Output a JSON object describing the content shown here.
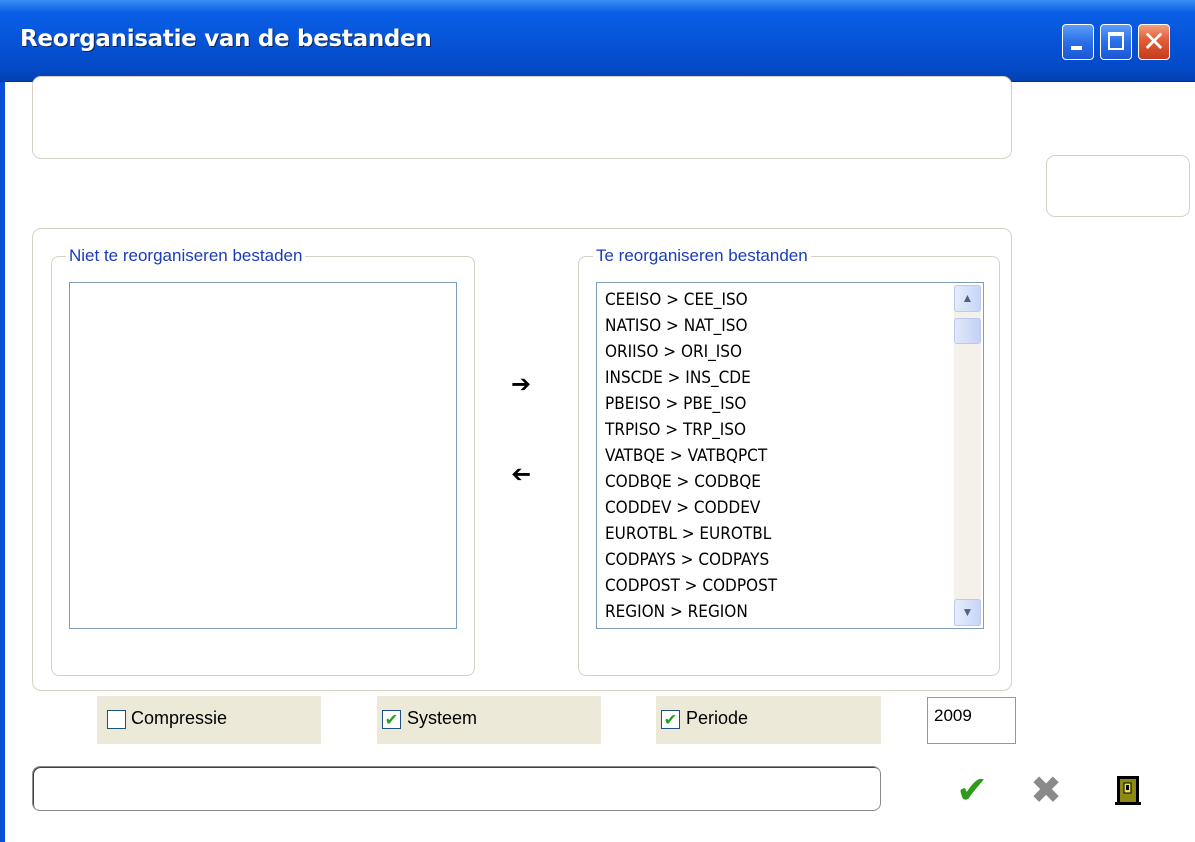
{
  "window": {
    "title": "Reorganisatie van de bestanden",
    "controls": {
      "minimize": "minimize-icon",
      "maximize": "maximize-icon",
      "close": "close-icon"
    }
  },
  "groups": {
    "left_title": "Niet te reorganiseren bestaden",
    "right_title": "Te reorganiseren bestanden"
  },
  "left_list": {
    "items": []
  },
  "right_list": {
    "items": [
      "CEEISO > CEE_ISO",
      "NATISO > NAT_ISO",
      "ORIISO > ORI_ISO",
      "INSCDE > INS_CDE",
      "PBEISO > PBE_ISO",
      "TRPISO > TRP_ISO",
      "VATBQE > VATBQPCT",
      "CODBQE > CODBQE",
      "CODDEV > CODDEV",
      "EUROTBL > EUROTBL",
      "CODPAYS > CODPAYS",
      "CODPOST > CODPOST",
      "REGION > REGION"
    ]
  },
  "transfer": {
    "move_right": "arrow-right-icon",
    "move_left": "arrow-left-icon"
  },
  "options": {
    "compressie": {
      "label": "Compressie",
      "checked": false
    },
    "systeem": {
      "label": "Systeem",
      "checked": true
    },
    "periode": {
      "label": "Periode",
      "checked": true
    },
    "year": "2009"
  },
  "actions": {
    "ok": "checkmark-icon",
    "cancel": "cross-icon",
    "exit": "door-icon"
  },
  "colors": {
    "title_bar": "#0654d8",
    "group_title": "#1a3cb8",
    "check": "#21a121"
  }
}
